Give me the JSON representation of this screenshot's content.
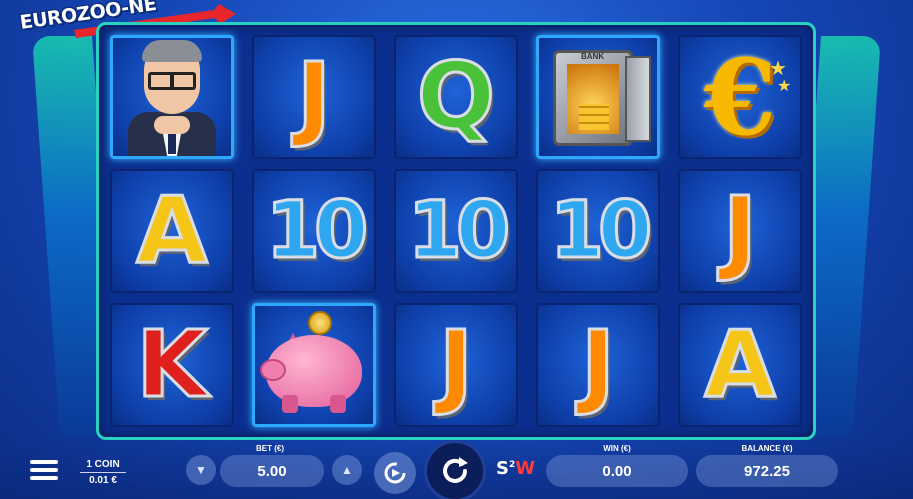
{
  "game": {
    "logo_text": "EUROZOO-NE"
  },
  "reels": {
    "rows": [
      [
        "portrait",
        "J",
        "Q",
        "vault",
        "euro"
      ],
      [
        "A",
        "10",
        "10",
        "10",
        "J"
      ],
      [
        "K",
        "piggy-bank",
        "J",
        "J",
        "A"
      ]
    ],
    "safe_label": "BANK"
  },
  "symbol_colors": {
    "J": "#ff8a00",
    "Q": "#49c23a",
    "A": "#f5c518",
    "K": "#e0201c",
    "10": "#2fa6f0"
  },
  "controls": {
    "menu_icon": "hamburger-menu-icon",
    "coin_label": "1 COIN",
    "coin_value": "0.01 €",
    "bet_label": "BET (€)",
    "bet_value": "5.00",
    "win_label": "WIN (€)",
    "win_value": "0.00",
    "balance_label": "BALANCE (€)",
    "balance_value": "972.25",
    "s2w_s": "S",
    "s2w_sup": "2",
    "s2w_w": "W"
  }
}
